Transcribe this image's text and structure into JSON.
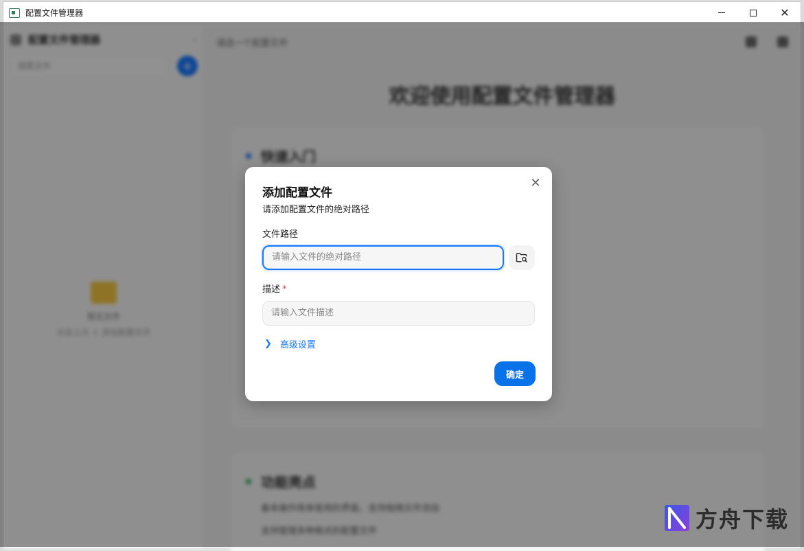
{
  "window": {
    "title": "配置文件管理器"
  },
  "sidebar": {
    "title": "配置文件管理器",
    "search_placeholder": "搜索文件",
    "add_label": "+",
    "empty_title": "暂无文件",
    "empty_hint": "点击上方 + 添加配置文件"
  },
  "main": {
    "breadcrumb": "请选一个配置文件",
    "welcome": "欢迎使用配置文件管理器",
    "card1_title": "快速入门",
    "card2_title": "功能亮点",
    "card2_lines": [
      "基本操作简单易用的界面，支持拖拽文件添加",
      "支持管理多种格式的配置文件"
    ]
  },
  "dialog": {
    "title": "添加配置文件",
    "subtitle": "请添加配置文件的绝对路径",
    "path_label": "文件路径",
    "path_placeholder": "请输入文件的绝对路径",
    "desc_label": "描述",
    "desc_required": "*",
    "desc_placeholder": "请输入文件描述",
    "advanced_label": "高级设置",
    "confirm_label": "确定"
  },
  "watermark": {
    "text": "方舟下载"
  },
  "colors": {
    "accent": "#1677ff",
    "confirm": "#0a72e8",
    "required": "#e5484d"
  }
}
